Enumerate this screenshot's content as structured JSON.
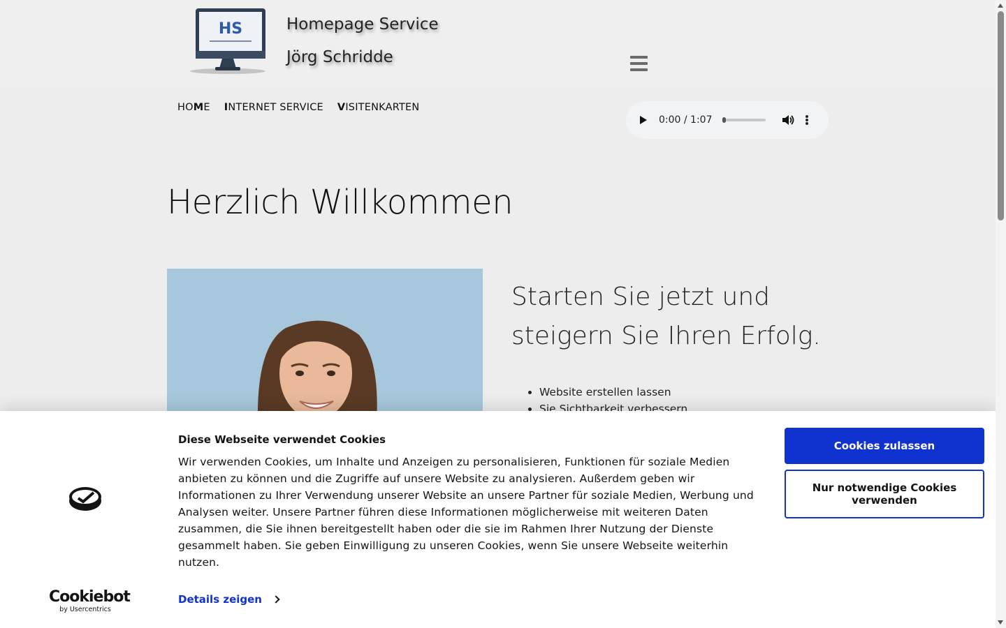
{
  "header": {
    "brand_line1": "Homepage Service",
    "brand_line2": "Jörg Schridde",
    "logo_text": "HS"
  },
  "nav": {
    "items": [
      {
        "first": "HO",
        "mid": "M",
        "rest": "E"
      },
      {
        "first": "I",
        "mid": "",
        "rest": "NTERNET SERVICE"
      },
      {
        "first": "V",
        "mid": "",
        "rest": "ISITENKARTEN"
      }
    ]
  },
  "audio": {
    "time": "0:00 / 1:07",
    "progress": 0
  },
  "main": {
    "heading": "Herzlich Willkommen",
    "subheading": "Starten Sie jetzt und steigern Sie Ihren Erfolg.",
    "list": [
      "Website erstellen lassen",
      "Sie Sichtbarkeit verbessern"
    ]
  },
  "cookie": {
    "title": "Diese Webseite verwendet Cookies",
    "text": "Wir verwenden Cookies, um Inhalte und Anzeigen zu personalisieren, Funktionen für soziale Medien anbieten zu können und die Zugriffe auf unsere Website zu analysieren. Außerdem geben wir Informationen zu Ihrer Verwendung unserer Website an unsere Partner für soziale Medien, Werbung und Analysen weiter. Unsere Partner führen diese Informationen möglicherweise mit weiteren Daten zusammen, die Sie ihnen bereitgestellt haben oder die sie im Rahmen Ihrer Nutzung der Dienste gesammelt haben. Sie geben Einwilligung zu unseren Cookies, wenn Sie unsere Webseite weiterhin nutzen.",
    "details_label": "Details zeigen",
    "allow_label": "Cookies zulassen",
    "necessary_label": "Nur notwendige Cookies verwenden",
    "brand_name": "Cookiebot",
    "brand_sub": "by Usercentrics"
  },
  "colors": {
    "accent": "#1032cf",
    "page_bg": "#ededed",
    "photo_bg": "#a7c8dc"
  },
  "icons": [
    "monitor-logo-icon",
    "hamburger-menu-icon",
    "play-icon",
    "volume-icon",
    "more-options-icon",
    "cookiebot-icon",
    "chevron-right-icon"
  ]
}
